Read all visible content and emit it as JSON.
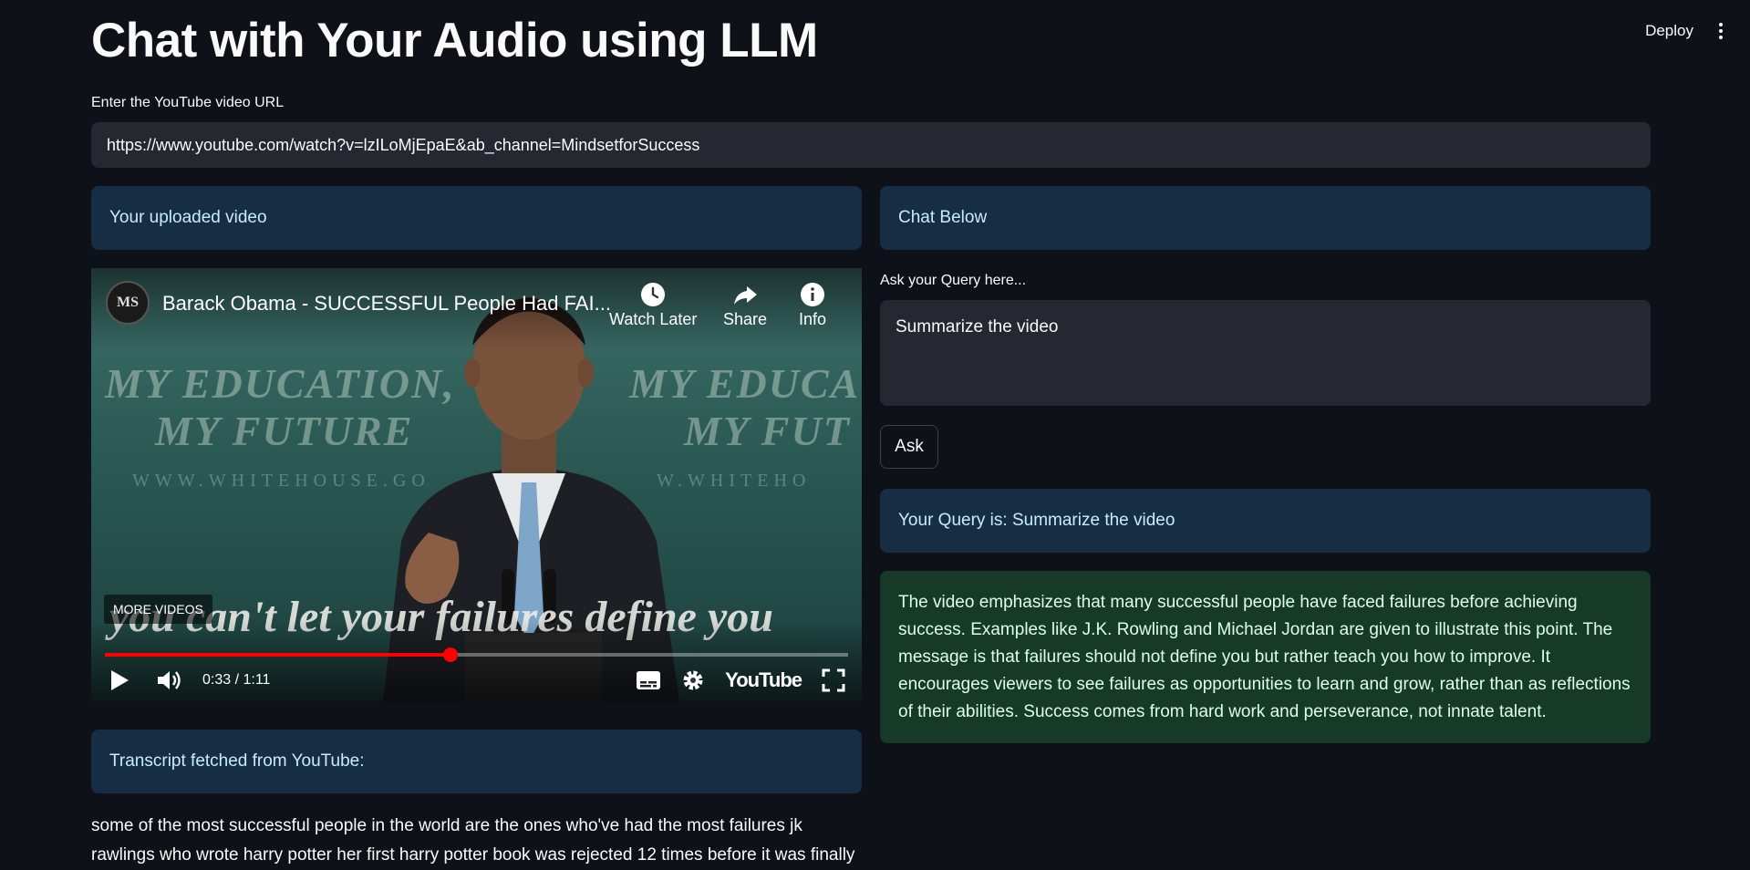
{
  "header": {
    "title": "Chat with Your Audio using LLM",
    "deploy_label": "Deploy",
    "menu_icon": "kebab-menu-icon"
  },
  "url_section": {
    "label": "Enter the YouTube video URL",
    "value": "https://www.youtube.com/watch?v=lzILoMjEpaE&ab_channel=MindsetforSuccess"
  },
  "left_panel": {
    "uploaded_info": "Your uploaded video",
    "transcript_info": "Transcript fetched from YouTube:",
    "transcript_text": "some of the most successful people in the world are the ones who've had the most failures jk rawlings who wrote harry potter her first harry potter book was rejected 12 times before it was finally"
  },
  "video_player": {
    "channel_avatar_text": "MS",
    "title": "Barack Obama - SUCCESSFUL People Had FAI...",
    "actions": [
      {
        "label": "Watch Later",
        "icon": "clock-icon"
      },
      {
        "label": "Share",
        "icon": "share-icon"
      },
      {
        "label": "Info",
        "icon": "info-icon"
      }
    ],
    "more_videos": "MORE VIDEOS",
    "background_text_1": "MY EDUCATION, MY FUTURE",
    "background_text_2": "WWW.WHITEHOUSE.GOV",
    "caption": "you can't let your failures define you",
    "current_time": "0:33",
    "duration": "1:11",
    "time_display": "0:33 / 1:11",
    "progress_fraction": 0.465,
    "logo": "YouTube",
    "accent_color": "#ff0000"
  },
  "right_panel": {
    "chat_info": "Chat Below",
    "query_label": "Ask your Query here...",
    "query_value": "Summarize the video",
    "ask_label": "Ask",
    "query_echo": "Your Query is: Summarize the video",
    "answer": "The video emphasizes that many successful people have faced failures before achieving success. Examples like J.K. Rowling and Michael Jordan are given to illustrate this point. The message is that failures should not define you but rather teach you how to improve. It encourages viewers to see failures as opportunities to learn and grow, rather than as reflections of their abilities. Success comes from hard work and perseverance, not innate talent."
  },
  "colors": {
    "background": "#0e1117",
    "info_box": "#172d43",
    "info_text": "#c7ebff",
    "success_box": "#173928",
    "success_text": "#dffde9",
    "input_bg": "#262730"
  }
}
